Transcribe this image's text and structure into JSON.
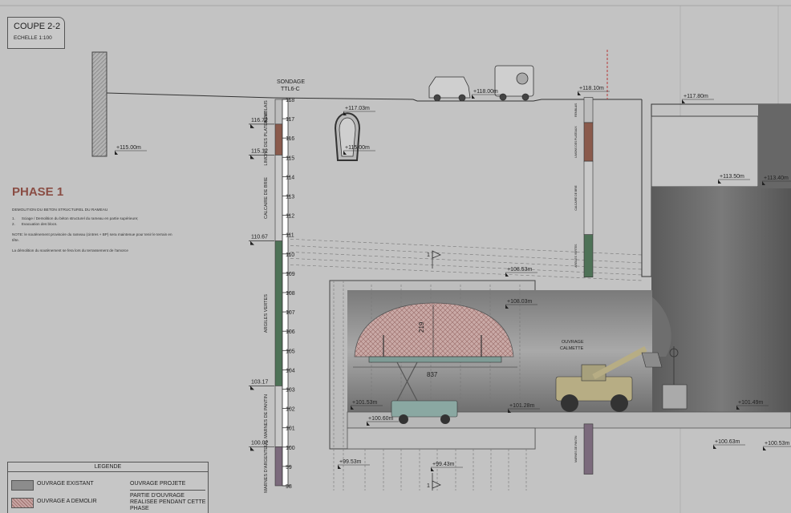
{
  "drawing": {
    "title": "COUPE 2-2",
    "scale": "ECHELLE  1:100",
    "phase_title": "PHASE 1",
    "sondage_label": "SONDAGE",
    "sondage_id": "TTL6-C",
    "notes": {
      "heading": "DEMOLITION DU BETON STRUCTUREL DU RAMEAU",
      "steps": [
        {
          "num": "1.",
          "text": "Sciage / Demolition du béton structurel du rameau en partie supérieure;"
        },
        {
          "num": "2.",
          "text": "Evacuation des blocs."
        }
      ],
      "note_1": "NOTE:  le soutènement provisoire du rameau (cintres + BP) sera maintenue pour tenir le terrain en tête.",
      "note_2": "La démolition du soutènement se fera lors du terrassement de l'amorce"
    }
  },
  "depth_scale": [
    "118",
    "117",
    "116",
    "115",
    "114",
    "113",
    "112",
    "111",
    "110",
    "109",
    "108",
    "107",
    "106",
    "105",
    "104",
    "103",
    "102",
    "101",
    "100",
    "99",
    "98"
  ],
  "strata_left": [
    {
      "elev": "116.72",
      "name": "REMBLAIS"
    },
    {
      "elev": "115.12",
      "name": "LIMONS DES PLATEAUX"
    },
    {
      "elev": "110.67",
      "name": "CALCAIRE DE BRIE"
    },
    {
      "elev": "103.17",
      "name": "ARGILES VERTES"
    },
    {
      "elev": "100.02",
      "name": "MARNES DE PANTIN"
    },
    {
      "elev": "",
      "name": "MARNES D'ARGENTEUIL"
    }
  ],
  "strata_right": [
    {
      "name": "REMBLAIS"
    },
    {
      "name": "LIMONS DES PLATEAUX"
    },
    {
      "name": "CALCAIRE DE BRIE"
    },
    {
      "name": "ARGILES VERTES"
    },
    {
      "name": "MARNES DE PANTIN"
    }
  ],
  "levels": [
    {
      "id": "lvl-118-10",
      "text": "+118.10m"
    },
    {
      "id": "lvl-118-00",
      "text": "+118.00m"
    },
    {
      "id": "lvl-117-80",
      "text": "+117.80m"
    },
    {
      "id": "lvl-117-03",
      "text": "+117.03m"
    },
    {
      "id": "lvl-115-00-left",
      "text": "+115.00m"
    },
    {
      "id": "lvl-115-00-shaft",
      "text": "+115.00m"
    },
    {
      "id": "lvl-113-50",
      "text": "+113.50m"
    },
    {
      "id": "lvl-113-40",
      "text": "+113.40m"
    },
    {
      "id": "lvl-108-53",
      "text": "+108.53m"
    },
    {
      "id": "lvl-108-03",
      "text": "+108.03m"
    },
    {
      "id": "lvl-101-53",
      "text": "+101.53m"
    },
    {
      "id": "lvl-101-28",
      "text": "+101.28m"
    },
    {
      "id": "lvl-101-49",
      "text": "+101.49m"
    },
    {
      "id": "lvl-100-60",
      "text": "+100.60m"
    },
    {
      "id": "lvl-100-63",
      "text": "+100.63m"
    },
    {
      "id": "lvl-100-53",
      "text": "+100.53m"
    },
    {
      "id": "lvl-99-53",
      "text": "+99.53m"
    },
    {
      "id": "lvl-99-43",
      "text": "+99.43m"
    }
  ],
  "dimensions": {
    "span": "837",
    "height": "219"
  },
  "ouvrage_label": [
    "OUVRAGE",
    "CALMETTE"
  ],
  "section_marker": "1",
  "legend": {
    "title": "LEGENDE",
    "items": [
      {
        "id": "existant",
        "text": "OUVRAGE EXISTANT",
        "color": "#8c8c8c"
      },
      {
        "id": "demolir",
        "text": "OUVRAGE A  DEMOLIR",
        "color": "#c7a5a3"
      },
      {
        "id": "projete",
        "text": "OUVRAGE PROJETE"
      },
      {
        "id": "partie",
        "text": "PARTIE D'OUVRAGE REALISEE PENDANT CETTE PHASE"
      }
    ]
  },
  "colors": {
    "background": "#c3c3c3",
    "structure_dark": "#5a5a5a",
    "demolish_hatch": "#b88c89",
    "strata_brown": "#8a5a4c",
    "strata_green": "#4e7257",
    "strata_purple": "#7b6a7c",
    "phase_title": "#8a4d44"
  }
}
